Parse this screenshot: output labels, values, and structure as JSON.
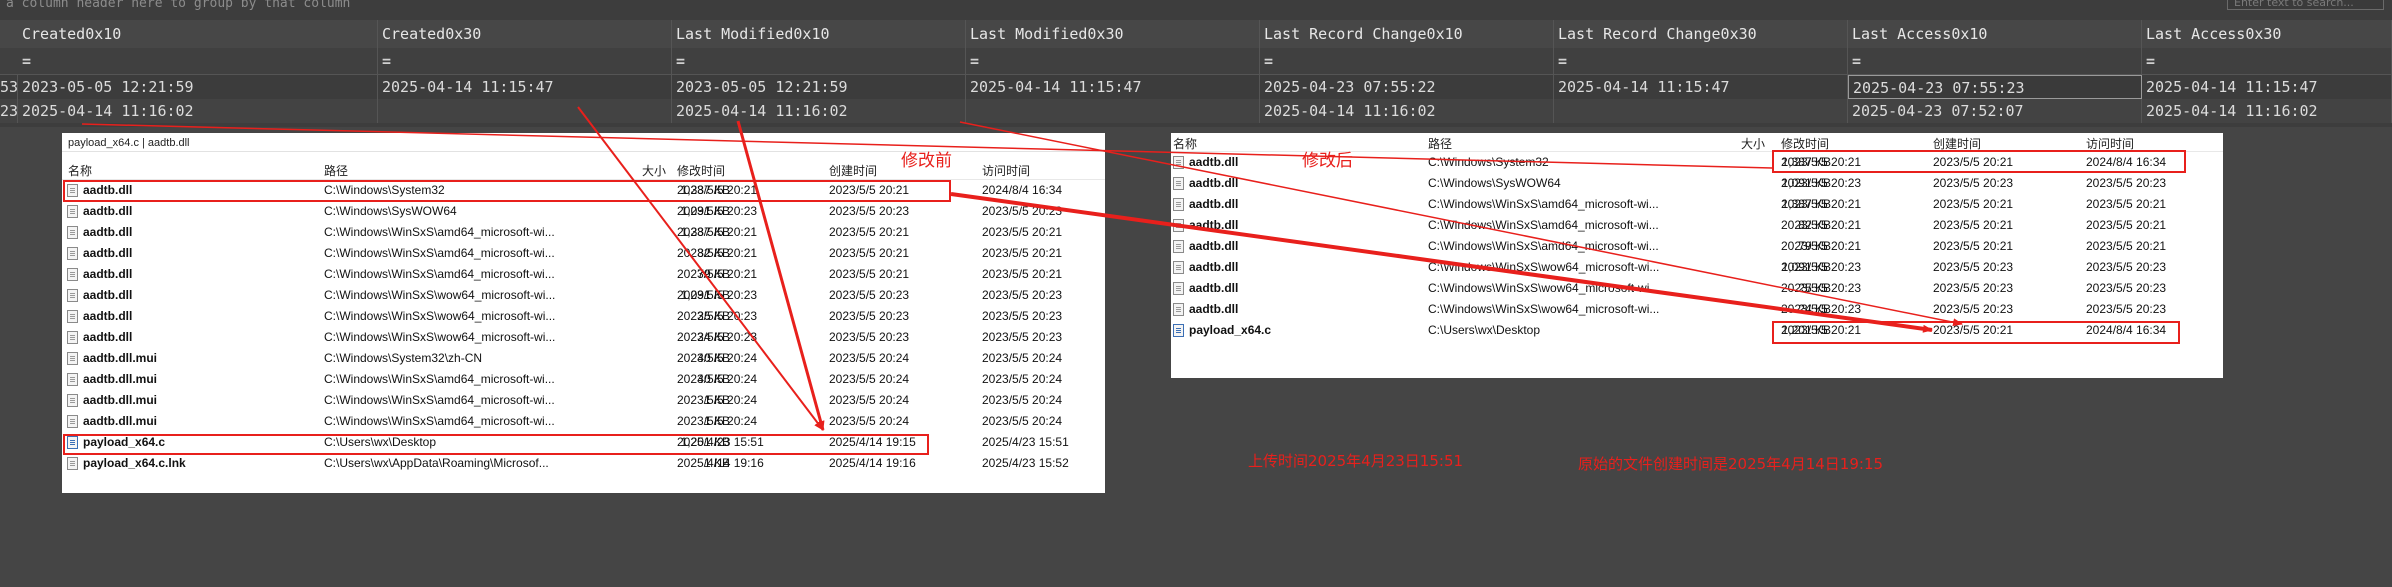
{
  "grid": {
    "group_hint": "a column header here to group by that column",
    "search_placeholder": "Enter text to search...",
    "columns": [
      "Created0x10",
      "Created0x30",
      "Last Modified0x10",
      "Last Modified0x30",
      "Last Record Change0x10",
      "Last Record Change0x30",
      "Last Access0x10",
      "Last Access0x30"
    ],
    "filter_symbol": "=",
    "left_fragments": [
      "53",
      "23"
    ],
    "rows": [
      [
        "2023-05-05 12:21:59",
        "2025-04-14 11:15:47",
        "2023-05-05 12:21:59",
        "2025-04-14 11:15:47",
        "2025-04-23 07:55:22",
        "2025-04-14 11:15:47",
        "2025-04-23 07:55:23",
        "2025-04-14 11:15:47"
      ],
      [
        "2025-04-14 11:16:02",
        "",
        "2025-04-14 11:16:02",
        "",
        "2025-04-14 11:16:02",
        "",
        "2025-04-23 07:52:07",
        "2025-04-14 11:16:02"
      ]
    ]
  },
  "left_panel": {
    "breadcrumb": "payload_x64.c | aadtb.dll",
    "headers": [
      "名称",
      "路径",
      "大小",
      "修改时间",
      "创建时间",
      "访问时间"
    ],
    "rows": [
      [
        "aadtb.dll",
        "C:\\Windows\\System32",
        "1,387 KB",
        "2023/5/5 20:21",
        "2023/5/5 20:21",
        "2024/8/4 16:34"
      ],
      [
        "aadtb.dll",
        "C:\\Windows\\SysWOW64",
        "1,091 KB",
        "2023/5/5 20:23",
        "2023/5/5 20:23",
        "2023/5/5 20:23"
      ],
      [
        "aadtb.dll",
        "C:\\Windows\\WinSxS\\amd64_microsoft-wi...",
        "1,387 KB",
        "2023/5/5 20:21",
        "2023/5/5 20:21",
        "2023/5/5 20:21"
      ],
      [
        "aadtb.dll",
        "C:\\Windows\\WinSxS\\amd64_microsoft-wi...",
        "82 KB",
        "2023/5/5 20:21",
        "2023/5/5 20:21",
        "2023/5/5 20:21"
      ],
      [
        "aadtb.dll",
        "C:\\Windows\\WinSxS\\amd64_microsoft-wi...",
        "79 KB",
        "2023/5/5 20:21",
        "2023/5/5 20:21",
        "2023/5/5 20:21"
      ],
      [
        "aadtb.dll",
        "C:\\Windows\\WinSxS\\wow64_microsoft-wi...",
        "1,091 KB",
        "2023/5/5 20:23",
        "2023/5/5 20:23",
        "2023/5/5 20:23"
      ],
      [
        "aadtb.dll",
        "C:\\Windows\\WinSxS\\wow64_microsoft-wi...",
        "25 KB",
        "2023/5/5 20:23",
        "2023/5/5 20:23",
        "2023/5/5 20:23"
      ],
      [
        "aadtb.dll",
        "C:\\Windows\\WinSxS\\wow64_microsoft-wi...",
        "24 KB",
        "2023/5/5 20:23",
        "2023/5/5 20:23",
        "2023/5/5 20:23"
      ],
      [
        "aadtb.dll.mui",
        "C:\\Windows\\System32\\zh-CN",
        "40 KB",
        "2023/5/5 20:24",
        "2023/5/5 20:24",
        "2023/5/5 20:24"
      ],
      [
        "aadtb.dll.mui",
        "C:\\Windows\\WinSxS\\amd64_microsoft-wi...",
        "40 KB",
        "2023/5/5 20:24",
        "2023/5/5 20:24",
        "2023/5/5 20:24"
      ],
      [
        "aadtb.dll.mui",
        "C:\\Windows\\WinSxS\\amd64_microsoft-wi...",
        "1 KB",
        "2023/5/5 20:24",
        "2023/5/5 20:24",
        "2023/5/5 20:24"
      ],
      [
        "aadtb.dll.mui",
        "C:\\Windows\\WinSxS\\amd64_microsoft-wi...",
        "1 KB",
        "2023/5/5 20:24",
        "2023/5/5 20:24",
        "2023/5/5 20:24"
      ],
      [
        "payload_x64.c",
        "C:\\Users\\wx\\Desktop",
        "1,201 KB",
        "2025/4/23 15:51",
        "2025/4/14 19:15",
        "2025/4/23 15:51"
      ],
      [
        "payload_x64.c.lnk",
        "C:\\Users\\wx\\AppData\\Roaming\\Microsof...",
        "1 KB",
        "2025/4/14 19:16",
        "2025/4/14 19:16",
        "2025/4/23 15:52"
      ]
    ]
  },
  "right_panel": {
    "headers": [
      "名称",
      "路径",
      "大小",
      "修改时间",
      "创建时间",
      "访问时间"
    ],
    "rows": [
      [
        "aadtb.dll",
        "C:\\Windows\\System32",
        "1,387 KB",
        "2023/5/5 20:21",
        "2023/5/5 20:21",
        "2024/8/4 16:34"
      ],
      [
        "aadtb.dll",
        "C:\\Windows\\SysWOW64",
        "1,091 KB",
        "2023/5/5 20:23",
        "2023/5/5 20:23",
        "2023/5/5 20:23"
      ],
      [
        "aadtb.dll",
        "C:\\Windows\\WinSxS\\amd64_microsoft-wi...",
        "1,387 KB",
        "2023/5/5 20:21",
        "2023/5/5 20:21",
        "2023/5/5 20:21"
      ],
      [
        "aadtb.dll",
        "C:\\Windows\\WinSxS\\amd64_microsoft-wi...",
        "82 KB",
        "2023/5/5 20:21",
        "2023/5/5 20:21",
        "2023/5/5 20:21"
      ],
      [
        "aadtb.dll",
        "C:\\Windows\\WinSxS\\amd64_microsoft-wi...",
        "79 KB",
        "2023/5/5 20:21",
        "2023/5/5 20:21",
        "2023/5/5 20:21"
      ],
      [
        "aadtb.dll",
        "C:\\Windows\\WinSxS\\wow64_microsoft-wi...",
        "1,091 KB",
        "2023/5/5 20:23",
        "2023/5/5 20:23",
        "2023/5/5 20:23"
      ],
      [
        "aadtb.dll",
        "C:\\Windows\\WinSxS\\wow64_microsoft-wi...",
        "25 KB",
        "2023/5/5 20:23",
        "2023/5/5 20:23",
        "2023/5/5 20:23"
      ],
      [
        "aadtb.dll",
        "C:\\Windows\\WinSxS\\wow64_microsoft-wi...",
        "24 KB",
        "2023/5/5 20:23",
        "2023/5/5 20:23",
        "2023/5/5 20:23"
      ],
      [
        "payload_x64.c",
        "C:\\Users\\wx\\Desktop",
        "1,201 KB",
        "2023/5/5 20:21",
        "2023/5/5 20:21",
        "2024/8/4 16:34"
      ]
    ]
  },
  "annotations": {
    "before_label": "修改前",
    "after_label": "修改后",
    "note_left": "上传时间2025年4月23日15:51",
    "note_right": "原始的文件创建时间是2025年4月14日19:15"
  },
  "colors": {
    "annotation_red": "#e8201c",
    "grid_bg": "#3d3d3d",
    "page_bg": "#454545"
  }
}
